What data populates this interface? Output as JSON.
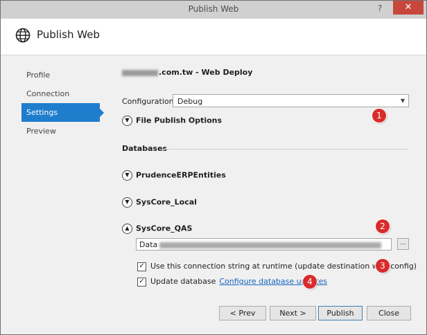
{
  "titlebar": {
    "title": "Publish Web",
    "help": "?",
    "close": "✕"
  },
  "header": {
    "title": "Publish Web",
    "icon": "globe-icon"
  },
  "nav": {
    "items": [
      "Profile",
      "Connection",
      "Settings",
      "Preview"
    ],
    "active": "Settings"
  },
  "site": {
    "name_suffix": ".com.tw - Web Deploy"
  },
  "configuration": {
    "label": "Configuration:",
    "value": "Debug"
  },
  "file_publish": {
    "label": "File Publish Options",
    "icon": "chevron-down"
  },
  "databases": {
    "heading": "Databases",
    "items": [
      {
        "label": "PrudenceERPEntities",
        "icon": "chevron-down"
      },
      {
        "label": "SysCore_Local",
        "icon": "chevron-down"
      },
      {
        "label": "SysCore_QAS",
        "icon": "chevron-up"
      }
    ],
    "connection_prefix": "Data",
    "browse_label": "..."
  },
  "options": {
    "use_connection_string": "Use this connection string at runtime (update destination web.config)",
    "update_database": "Update database",
    "configure_link": "Configure database updates"
  },
  "buttons": {
    "prev": "< Prev",
    "next": "Next >",
    "publish": "Publish",
    "close": "Close"
  },
  "badges": [
    "1",
    "2",
    "3",
    "4"
  ],
  "colors": {
    "accent": "#1f7dcd",
    "badge": "#d92b2b",
    "link": "#1565c0"
  }
}
